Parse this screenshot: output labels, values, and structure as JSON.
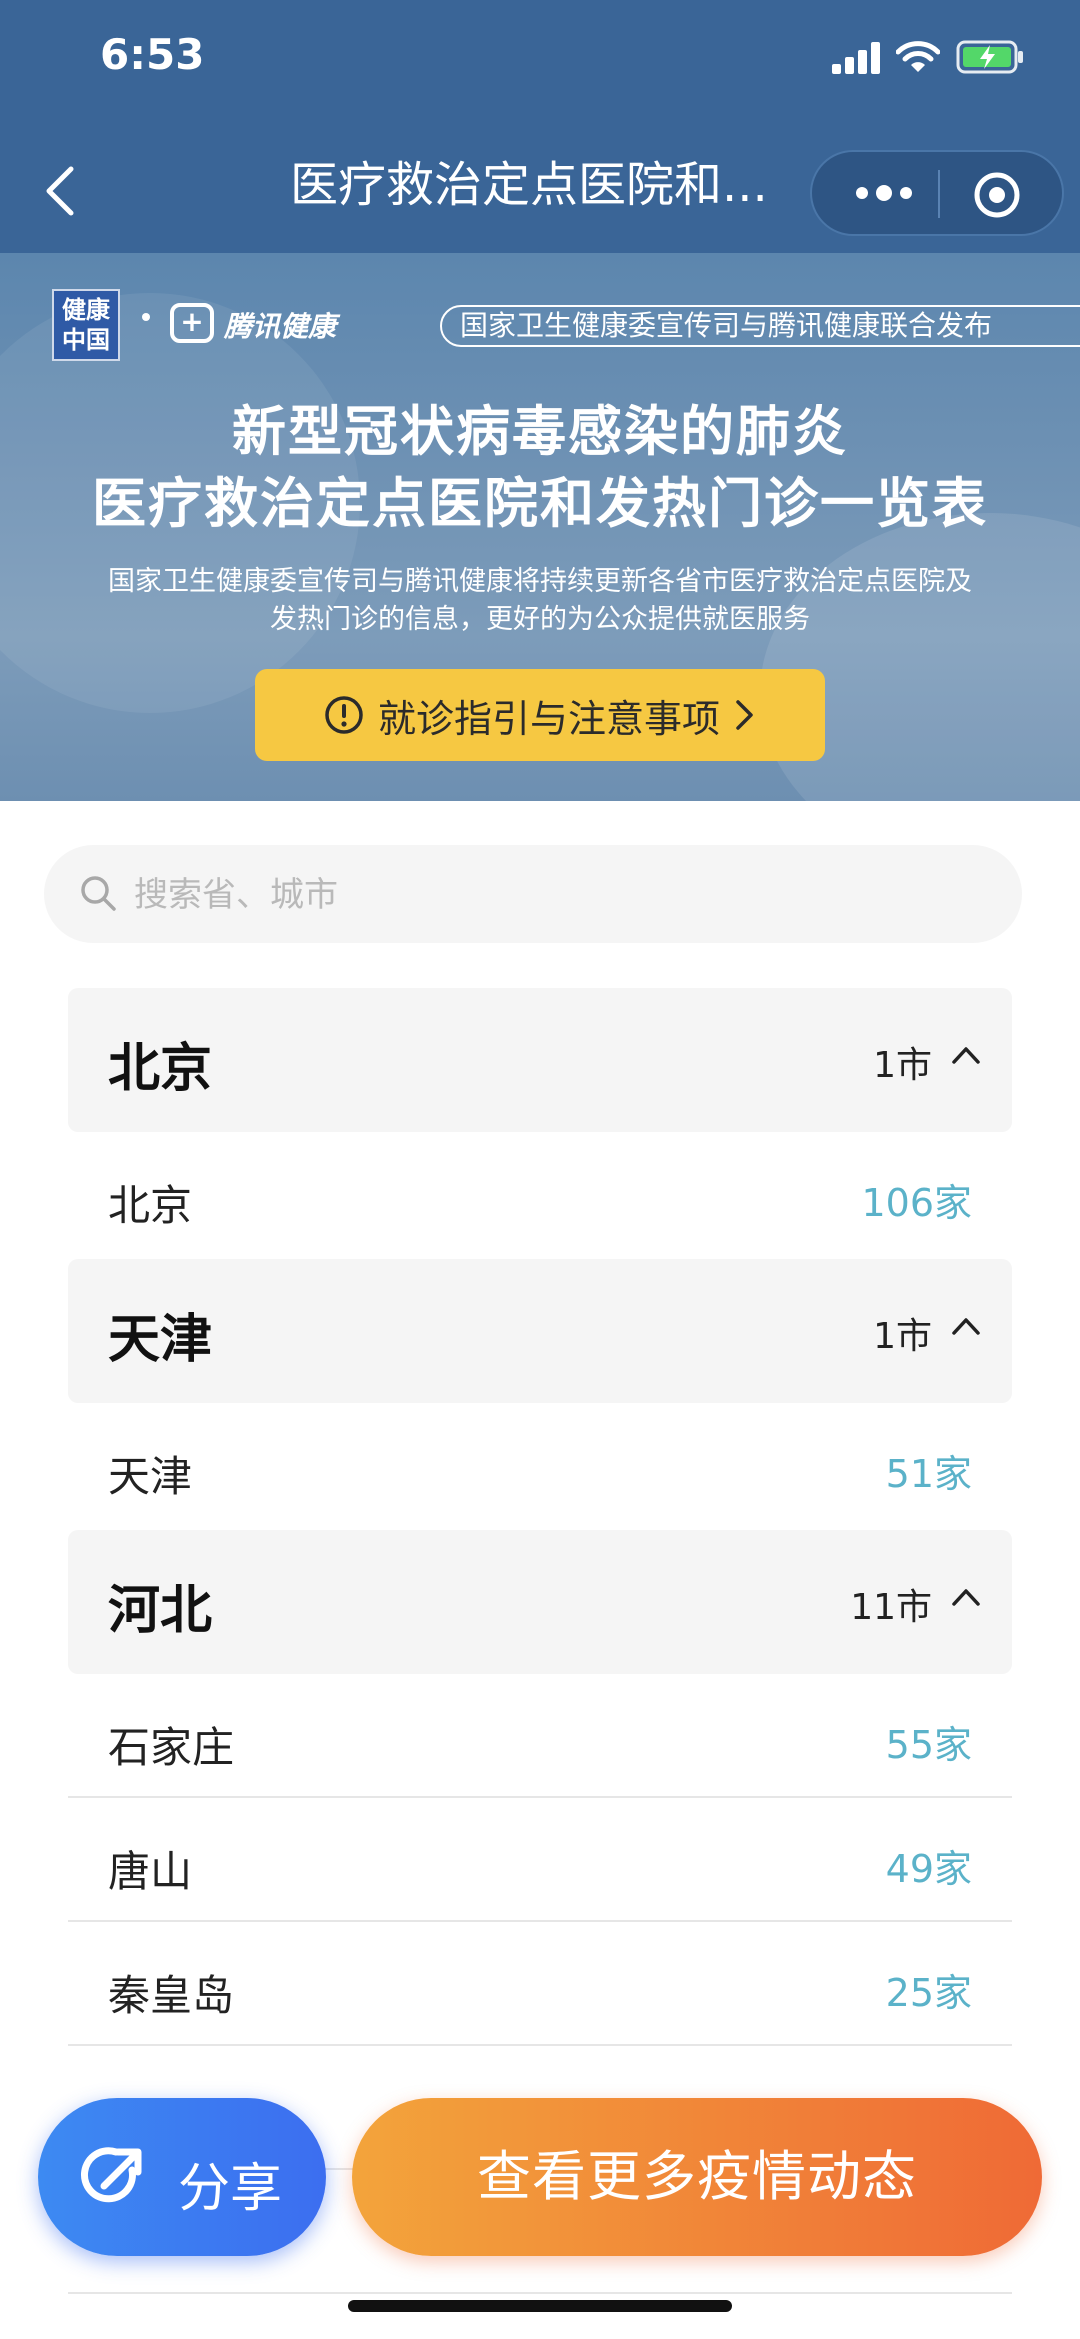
{
  "status_bar": {
    "time": "6:53"
  },
  "nav": {
    "title": "医疗救治定点医院和..."
  },
  "banner": {
    "logo_text_line1": "健康",
    "logo_text_line2": "中国",
    "brand_name": "腾讯健康",
    "publisher": "国家卫生健康委宣传司与腾讯健康联合发布",
    "headline_line1": "新型冠状病毒感染的肺炎",
    "headline_line2": "医疗救治定点医院和发热门诊一览表",
    "desc_line1": "国家卫生健康委宣传司与腾讯健康将持续更新各省市医疗救治定点医院及",
    "desc_line2": "发热门诊的信息，更好的为公众提供就医服务",
    "guide_button": "就诊指引与注意事项"
  },
  "search": {
    "placeholder": "搜索省、城市"
  },
  "provinces": [
    {
      "name": "北京",
      "count": "1市",
      "cities": [
        {
          "name": "北京",
          "count": "106家"
        }
      ]
    },
    {
      "name": "天津",
      "count": "1市",
      "cities": [
        {
          "name": "天津",
          "count": "51家"
        }
      ]
    },
    {
      "name": "河北",
      "count": "11市",
      "cities": [
        {
          "name": "石家庄",
          "count": "55家"
        },
        {
          "name": "唐山",
          "count": "49家"
        },
        {
          "name": "秦皇岛",
          "count": "25家"
        }
      ]
    }
  ],
  "actions": {
    "share": "分享",
    "more": "查看更多疫情动态"
  },
  "colors": {
    "header": "#3a6597",
    "accent_count": "#5bb2c9",
    "guide_button": "#f6c842",
    "share": "#3c6ef0",
    "more": "#ef6a36"
  }
}
